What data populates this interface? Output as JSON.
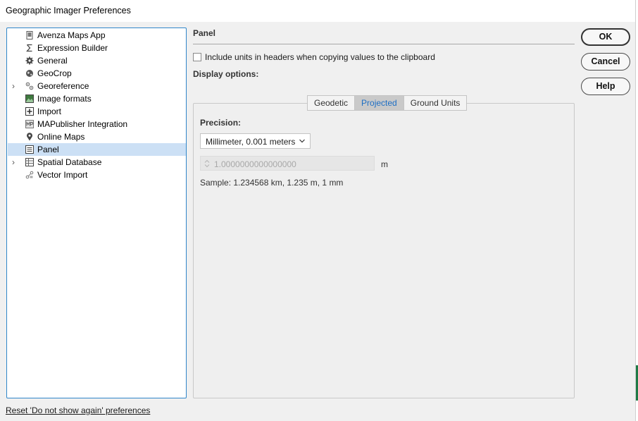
{
  "window": {
    "title": "Geographic Imager Preferences"
  },
  "tree": {
    "items": [
      {
        "label": "Avenza Maps App",
        "icon": "phone-icon",
        "expandable": false,
        "selected": false
      },
      {
        "label": "Expression Builder",
        "icon": "sigma-icon",
        "expandable": false,
        "selected": false
      },
      {
        "label": "General",
        "icon": "gear-icon",
        "expandable": false,
        "selected": false
      },
      {
        "label": "GeoCrop",
        "icon": "globe-icon",
        "expandable": false,
        "selected": false
      },
      {
        "label": "Georeference",
        "icon": "georeference-icon",
        "expandable": true,
        "selected": false
      },
      {
        "label": "Image formats",
        "icon": "image-icon",
        "expandable": false,
        "selected": false
      },
      {
        "label": "Import",
        "icon": "import-icon",
        "expandable": false,
        "selected": false
      },
      {
        "label": "MAPublisher Integration",
        "icon": "mapublisher-icon",
        "expandable": false,
        "selected": false
      },
      {
        "label": "Online Maps",
        "icon": "map-pin-icon",
        "expandable": false,
        "selected": false
      },
      {
        "label": "Panel",
        "icon": "panel-icon",
        "expandable": false,
        "selected": true
      },
      {
        "label": "Spatial Database",
        "icon": "database-icon",
        "expandable": true,
        "selected": false
      },
      {
        "label": "Vector Import",
        "icon": "vector-import-icon",
        "expandable": false,
        "selected": false
      }
    ],
    "expander_glyph": "›"
  },
  "panel": {
    "title": "Panel",
    "include_units_label": "Include units in headers when copying values to the clipboard",
    "include_units_checked": false,
    "display_options_label": "Display options:",
    "tabs": [
      {
        "label": "Geodetic",
        "active": false
      },
      {
        "label": "Projected",
        "active": true
      },
      {
        "label": "Ground Units",
        "active": false
      }
    ],
    "precision_label": "Precision:",
    "precision_value": "Millimeter, 0.001 meters",
    "custom_value": "1.0000000000000000",
    "unit": "m",
    "sample_text": "Sample: 1.234568 km, 1.235 m, 1 mm"
  },
  "buttons": {
    "ok": "OK",
    "cancel": "Cancel",
    "help": "Help"
  },
  "footer": {
    "reset_link": "Reset 'Do not show again' preferences"
  },
  "colors": {
    "selection": "#cce0f5",
    "tree_border": "#2f86c9",
    "active_tab_text": "#1e6fc4"
  }
}
